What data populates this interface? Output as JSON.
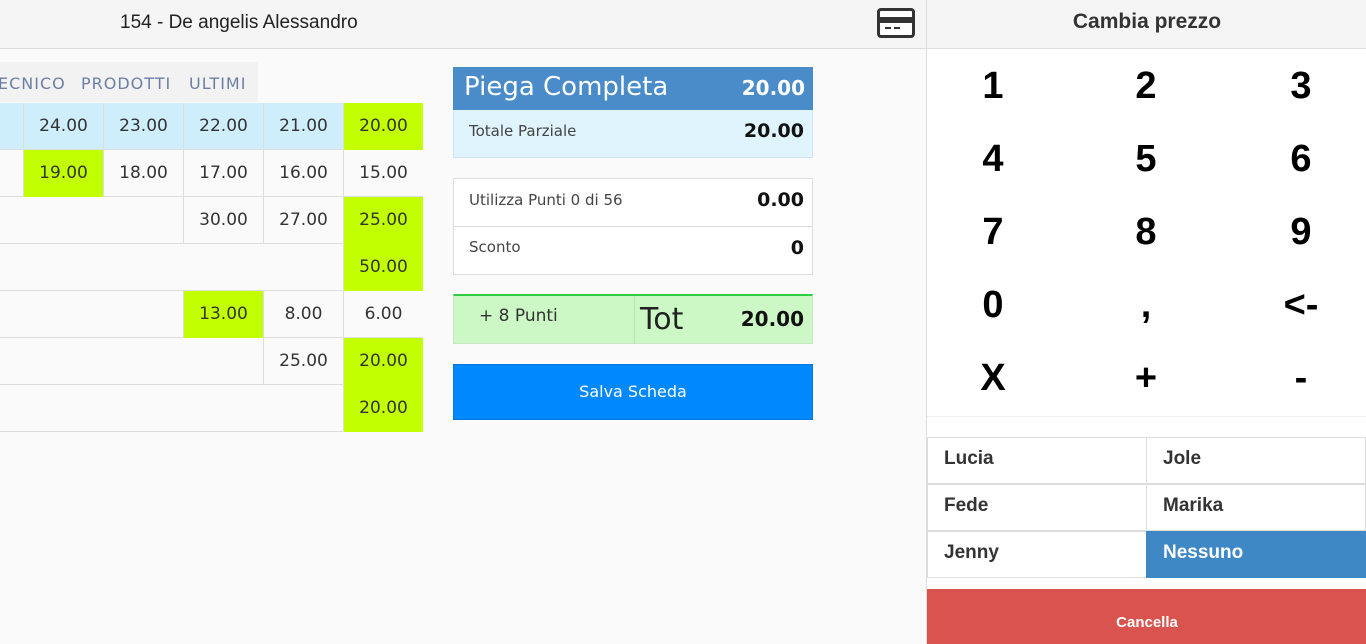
{
  "header": {
    "client_title": "154 - De angelis Alessandro",
    "card_icon": "credit-card-icon"
  },
  "tabs": [
    {
      "label": "ECNICO"
    },
    {
      "label": "PRODOTTI"
    },
    {
      "label": "ULTIMI"
    }
  ],
  "price_grid": {
    "rows": [
      [
        "24.00",
        "23.00",
        "22.00",
        "21.00",
        "20.00"
      ],
      [
        "19.00",
        "18.00",
        "17.00",
        "16.00",
        "15.00"
      ],
      [
        "",
        "",
        "30.00",
        "27.00",
        "25.00"
      ],
      [
        "",
        "",
        "",
        "",
        "50.00"
      ],
      [
        "",
        "",
        "13.00",
        "8.00",
        "6.00"
      ],
      [
        "",
        "",
        "",
        "25.00",
        "20.00"
      ],
      [
        "",
        "",
        "",
        "",
        "20.00"
      ]
    ],
    "highlight_color": "#c2ff00"
  },
  "summary": {
    "service_name": "Piega Completa",
    "service_price": "20.00",
    "partial_label": "Totale Parziale",
    "partial_value": "20.00",
    "points_label": "Utilizza Punti 0 di 56",
    "points_value": "0.00",
    "discount_label": "Sconto",
    "discount_value": "0",
    "bonus_points": "+ 8 Punti",
    "tot_label": "Tot",
    "tot_value": "20.00",
    "save_label": "Salva Scheda"
  },
  "right_panel": {
    "title": "Cambia prezzo",
    "keys": [
      "1",
      "2",
      "3",
      "4",
      "5",
      "6",
      "7",
      "8",
      "9",
      "0",
      ",",
      "<-",
      "X",
      "+",
      "-"
    ],
    "staff": [
      {
        "name": "Lucia",
        "active": false
      },
      {
        "name": "Jole",
        "active": false
      },
      {
        "name": "Fede",
        "active": false
      },
      {
        "name": "Marika",
        "active": false
      },
      {
        "name": "Jenny",
        "active": false
      },
      {
        "name": "Nessuno",
        "active": true
      }
    ],
    "cancel_label": "Cancella"
  },
  "colors": {
    "header_blue": "#4a8cc9",
    "save_blue": "#0088ff",
    "cancel_red": "#d9534f",
    "tot_green": "#ccf8c6"
  }
}
